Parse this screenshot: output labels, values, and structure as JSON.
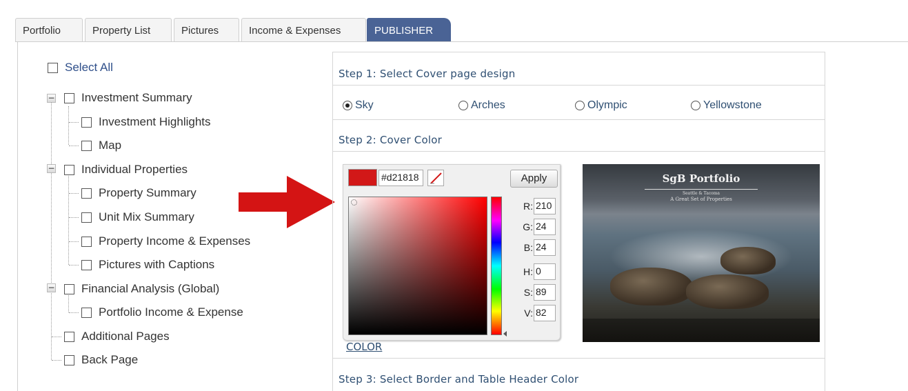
{
  "tabs": [
    {
      "label": "Portfolio",
      "active": false
    },
    {
      "label": "Property List",
      "active": false
    },
    {
      "label": "Pictures",
      "active": false
    },
    {
      "label": "Income & Expenses",
      "active": false
    },
    {
      "label": "PUBLISHER",
      "active": true
    }
  ],
  "tree": {
    "select_all": "Select All",
    "items": [
      {
        "label": "Investment Summary",
        "level": 0
      },
      {
        "label": "Investment Highlights",
        "level": 1
      },
      {
        "label": "Map",
        "level": 1
      },
      {
        "label": "Individual Properties",
        "level": 0
      },
      {
        "label": "Property Summary",
        "level": 1
      },
      {
        "label": "Unit Mix Summary",
        "level": 1
      },
      {
        "label": "Property Income & Expenses",
        "level": 1
      },
      {
        "label": "Pictures with Captions",
        "level": 1
      },
      {
        "label": "Financial Analysis (Global)",
        "level": 0
      },
      {
        "label": "Portfolio Income & Expense",
        "level": 1
      },
      {
        "label": "Additional Pages",
        "level": 0
      },
      {
        "label": "Back Page",
        "level": 0
      }
    ]
  },
  "steps": {
    "step1": "Step 1: Select Cover page design",
    "step2": "Step 2: Cover Color",
    "step3": "Step 3: Select Border and Table Header Color"
  },
  "cover_designs": [
    {
      "label": "Sky",
      "selected": true
    },
    {
      "label": "Arches",
      "selected": false
    },
    {
      "label": "Olympic",
      "selected": false
    },
    {
      "label": "Yellowstone",
      "selected": false
    }
  ],
  "color_picker": {
    "hex": "#d21818",
    "apply_label": "Apply",
    "r_label": "R:",
    "r": "210",
    "g_label": "G:",
    "g": "24",
    "b_label": "B:",
    "b": "24",
    "h_label": "H:",
    "h": "0",
    "s_label": "S:",
    "s": "89",
    "v_label": "V:",
    "v": "82",
    "swatch_color": "#d21818",
    "link_label": "COLOR"
  },
  "cover_preview": {
    "title": "SgB Portfolio",
    "subtitle_1": "Seattle & Tacoma",
    "subtitle_2": "A Great Set of Properties"
  },
  "colors": {
    "accent": "#4a6395",
    "step_text": "#2f4f72",
    "arrow": "#d41414"
  }
}
